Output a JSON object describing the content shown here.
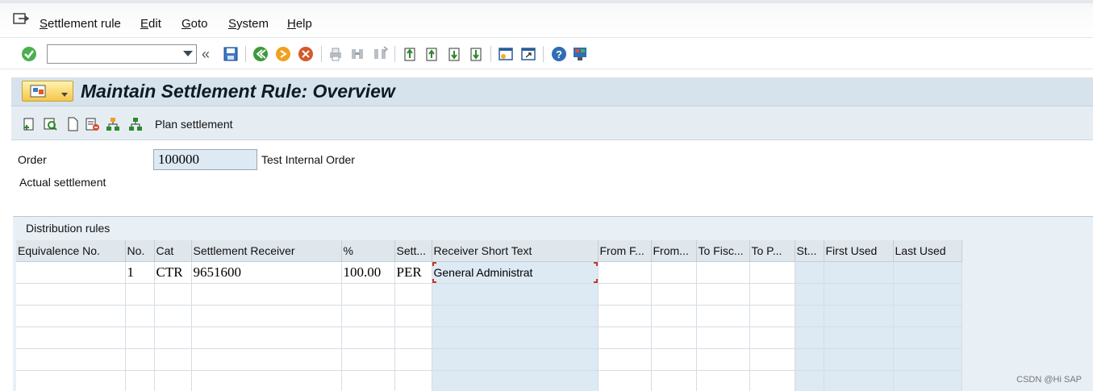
{
  "menu": {
    "items": [
      "Settlement rule",
      "Edit",
      "Goto",
      "System",
      "Help"
    ]
  },
  "toolbar": {
    "command_value": "",
    "icons": [
      "enter-icon",
      "back-double-icon",
      "save-icon",
      "back-icon",
      "exit-icon",
      "cancel-icon",
      "print-icon",
      "find-icon",
      "find-next-icon",
      "first-page-icon",
      "previous-page-icon",
      "next-page-icon",
      "last-page-icon",
      "new-session-icon",
      "shortcut-icon",
      "help-icon",
      "customize-layout-icon"
    ]
  },
  "title": "Maintain Settlement Rule: Overview",
  "app_toolbar": {
    "plan_settlement_label": "Plan settlement"
  },
  "header": {
    "order_label": "Order",
    "order_value": "100000",
    "order_desc": "Test Internal Order",
    "actual_settlement_label": "Actual settlement"
  },
  "distribution": {
    "title": "Distribution rules",
    "columns": [
      "Equivalence No.",
      "No.",
      "Cat",
      "Settlement Receiver",
      "%",
      "Sett...",
      "Receiver Short Text",
      "From F...",
      "From...",
      "To Fisc...",
      "To P...",
      "St...",
      "First Used",
      "Last Used"
    ],
    "rows": [
      [
        "",
        "1",
        "CTR",
        "9651600",
        "100.00",
        "PER",
        "General Administrat",
        "",
        "",
        "",
        "",
        "",
        "",
        ""
      ],
      [
        "",
        "",
        "",
        "",
        "",
        "",
        "",
        "",
        "",
        "",
        "",
        "",
        "",
        ""
      ],
      [
        "",
        "",
        "",
        "",
        "",
        "",
        "",
        "",
        "",
        "",
        "",
        "",
        "",
        ""
      ],
      [
        "",
        "",
        "",
        "",
        "",
        "",
        "",
        "",
        "",
        "",
        "",
        "",
        "",
        ""
      ],
      [
        "",
        "",
        "",
        "",
        "",
        "",
        "",
        "",
        "",
        "",
        "",
        "",
        "",
        ""
      ],
      [
        "",
        "",
        "",
        "",
        "",
        "",
        "",
        "",
        "",
        "",
        "",
        "",
        "",
        ""
      ]
    ]
  },
  "watermark": "CSDN @Hi SAP"
}
